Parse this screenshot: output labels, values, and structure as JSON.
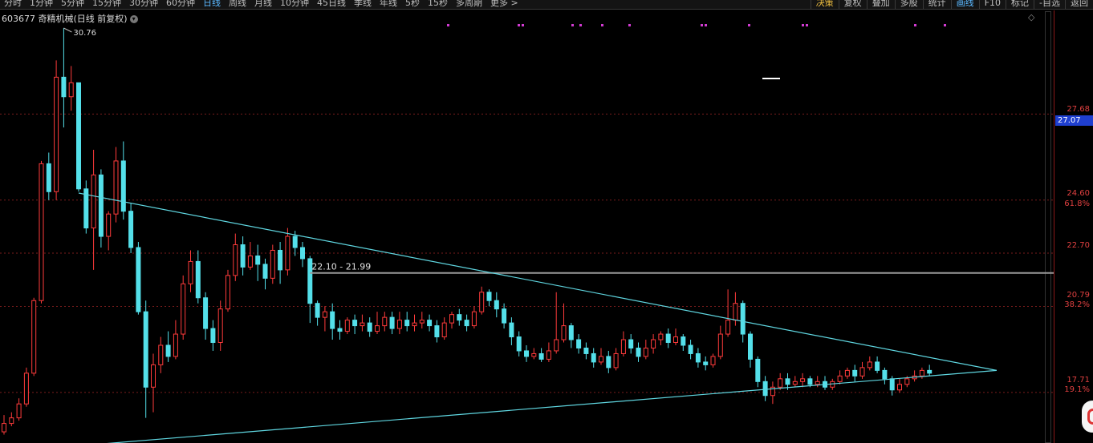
{
  "toolbar": {
    "periods": [
      "分时",
      "1分钟",
      "5分钟",
      "15分钟",
      "30分钟",
      "60分钟",
      "日线",
      "周线",
      "月线",
      "10分钟",
      "45日线",
      "季线",
      "年线",
      "5秒",
      "15秒",
      "多周期",
      "更多 >"
    ],
    "active_period": "日线",
    "right_buttons": [
      "决策",
      "复权",
      "叠加",
      "多股",
      "统计",
      "画线",
      "F10",
      "标记",
      "-自选",
      "返回"
    ]
  },
  "stock": {
    "code": "603677",
    "name": "奇精机械",
    "mode": "(日线 前复权)"
  },
  "price_labels": {
    "high_marker": "30.76",
    "range_label": "22.10 - 21.99",
    "current_price": "27.07"
  },
  "axis": {
    "ticks": [
      "27.68",
      "24.60",
      "22.70",
      "20.79",
      "17.71"
    ],
    "fib": [
      "61.8%",
      "38.2%",
      "19.1%"
    ]
  },
  "colors": {
    "up": "#ff3b3b",
    "down": "#54e0ea",
    "trend_line": "#5fd6e0",
    "level_line": "#9a9a9a",
    "grid": "#7a1c1c",
    "marker": "#d23bd2"
  },
  "chart_data": {
    "type": "candlestick",
    "ylim": [
      16.5,
      31.5
    ],
    "candles": [
      [
        16.3,
        16.6,
        16.9,
        16.2
      ],
      [
        16.6,
        16.8,
        17.0,
        16.5
      ],
      [
        16.8,
        17.3,
        17.5,
        16.7
      ],
      [
        17.3,
        18.4,
        18.6,
        17.2
      ],
      [
        18.4,
        21.0,
        21.1,
        18.3
      ],
      [
        21.0,
        25.9,
        26.0,
        20.9
      ],
      [
        25.9,
        24.9,
        26.3,
        24.6
      ],
      [
        24.9,
        29.0,
        29.6,
        24.6
      ],
      [
        29.0,
        28.3,
        30.76,
        27.2
      ],
      [
        28.3,
        28.8,
        29.4,
        27.8
      ],
      [
        28.8,
        25.0,
        25.5,
        24.9
      ],
      [
        25.0,
        23.6,
        25.3,
        23.4
      ],
      [
        23.6,
        25.5,
        26.4,
        22.1
      ],
      [
        25.5,
        23.3,
        25.7,
        22.9
      ],
      [
        23.3,
        24.1,
        24.2,
        22.8
      ],
      [
        24.1,
        26.0,
        26.5,
        23.8
      ],
      [
        26.0,
        24.2,
        26.7,
        23.9
      ],
      [
        24.2,
        22.9,
        24.5,
        22.7
      ],
      [
        22.9,
        20.6,
        23.1,
        20.5
      ],
      [
        20.6,
        17.9,
        21.0,
        16.8
      ],
      [
        17.9,
        18.7,
        19.1,
        17.0
      ],
      [
        18.7,
        19.4,
        19.7,
        18.4
      ],
      [
        19.4,
        19.0,
        19.9,
        18.8
      ],
      [
        19.0,
        19.8,
        20.3,
        18.9
      ],
      [
        19.8,
        21.6,
        21.9,
        19.6
      ],
      [
        21.6,
        22.4,
        22.8,
        21.3
      ],
      [
        22.4,
        21.1,
        22.8,
        20.9
      ],
      [
        21.1,
        20.0,
        21.3,
        19.6
      ],
      [
        20.0,
        19.5,
        20.3,
        19.2
      ],
      [
        19.5,
        20.7,
        21.0,
        19.2
      ],
      [
        20.7,
        21.9,
        22.1,
        20.6
      ],
      [
        21.9,
        23.0,
        23.4,
        21.7
      ],
      [
        23.0,
        22.2,
        23.3,
        21.9
      ],
      [
        22.2,
        22.6,
        23.1,
        22.1
      ],
      [
        22.6,
        22.3,
        23.0,
        21.7
      ],
      [
        22.3,
        21.8,
        22.5,
        21.4
      ],
      [
        21.8,
        22.8,
        23.0,
        21.6
      ],
      [
        22.8,
        22.1,
        23.1,
        21.6
      ],
      [
        22.1,
        23.3,
        23.6,
        21.9
      ],
      [
        23.3,
        22.9,
        23.5,
        22.6
      ],
      [
        22.9,
        22.5,
        23.1,
        22.2
      ],
      [
        22.5,
        20.9,
        22.6,
        20.2
      ],
      [
        20.9,
        20.4,
        21.0,
        20.1
      ],
      [
        20.4,
        20.6,
        20.8,
        19.9
      ],
      [
        20.6,
        20.0,
        20.9,
        19.6
      ],
      [
        20.0,
        19.9,
        20.3,
        19.6
      ],
      [
        19.9,
        20.3,
        20.4,
        19.8
      ],
      [
        20.3,
        20.1,
        20.5,
        19.8
      ],
      [
        20.1,
        20.2,
        20.5,
        19.9
      ],
      [
        20.2,
        19.9,
        20.4,
        19.7
      ],
      [
        19.9,
        20.1,
        20.6,
        19.8
      ],
      [
        20.1,
        20.4,
        20.6,
        19.9
      ],
      [
        20.4,
        20.0,
        20.6,
        19.8
      ],
      [
        20.0,
        20.3,
        20.6,
        19.8
      ],
      [
        20.3,
        20.1,
        20.6,
        19.9
      ],
      [
        20.1,
        20.2,
        20.5,
        19.9
      ],
      [
        20.2,
        20.3,
        20.6,
        20.0
      ],
      [
        20.3,
        20.1,
        20.5,
        19.9
      ],
      [
        20.1,
        19.7,
        20.3,
        19.5
      ],
      [
        19.7,
        20.2,
        20.4,
        19.6
      ],
      [
        20.2,
        20.5,
        20.6,
        20.0
      ],
      [
        20.5,
        20.3,
        20.7,
        20.1
      ],
      [
        20.3,
        20.1,
        20.5,
        19.9
      ],
      [
        20.1,
        20.6,
        20.8,
        20.0
      ],
      [
        20.6,
        21.3,
        21.5,
        20.5
      ],
      [
        21.3,
        21.0,
        21.4,
        20.8
      ],
      [
        21.0,
        20.7,
        21.3,
        20.4
      ],
      [
        20.7,
        20.2,
        20.9,
        20.0
      ],
      [
        20.2,
        19.7,
        20.4,
        19.4
      ],
      [
        19.7,
        19.2,
        19.9,
        19.0
      ],
      [
        19.2,
        19.0,
        19.4,
        18.8
      ],
      [
        19.0,
        19.1,
        19.3,
        18.9
      ],
      [
        19.1,
        18.9,
        19.3,
        18.8
      ],
      [
        18.9,
        19.2,
        19.5,
        18.8
      ],
      [
        19.2,
        19.6,
        21.3,
        19.1
      ],
      [
        19.6,
        20.1,
        20.9,
        19.5
      ],
      [
        20.1,
        19.6,
        20.2,
        19.3
      ],
      [
        19.6,
        19.3,
        19.8,
        19.1
      ],
      [
        19.3,
        19.1,
        19.5,
        18.9
      ],
      [
        19.1,
        18.8,
        19.3,
        18.6
      ],
      [
        18.8,
        19.0,
        19.3,
        18.7
      ],
      [
        19.0,
        18.6,
        19.2,
        18.4
      ],
      [
        18.6,
        19.1,
        19.3,
        18.5
      ],
      [
        19.1,
        19.6,
        19.9,
        19.0
      ],
      [
        19.6,
        19.3,
        19.8,
        19.1
      ],
      [
        19.3,
        19.0,
        19.5,
        18.8
      ],
      [
        19.0,
        19.3,
        19.6,
        18.9
      ],
      [
        19.3,
        19.6,
        19.8,
        19.1
      ],
      [
        19.6,
        19.8,
        19.9,
        19.4
      ],
      [
        19.8,
        19.5,
        20.0,
        19.3
      ],
      [
        19.5,
        19.7,
        20.0,
        19.4
      ],
      [
        19.7,
        19.4,
        19.8,
        19.2
      ],
      [
        19.4,
        19.1,
        19.6,
        18.9
      ],
      [
        19.1,
        18.8,
        19.3,
        18.6
      ],
      [
        18.8,
        18.7,
        19.0,
        18.5
      ],
      [
        18.7,
        19.0,
        19.1,
        18.6
      ],
      [
        19.0,
        19.8,
        20.1,
        18.9
      ],
      [
        19.8,
        20.3,
        21.4,
        19.7
      ],
      [
        20.3,
        20.9,
        21.3,
        20.1
      ],
      [
        20.9,
        19.8,
        21.0,
        19.5
      ],
      [
        19.8,
        18.9,
        19.9,
        18.6
      ],
      [
        18.9,
        18.1,
        19.0,
        17.9
      ],
      [
        18.1,
        17.6,
        18.3,
        17.4
      ],
      [
        17.6,
        17.9,
        18.1,
        17.3
      ],
      [
        17.9,
        18.2,
        18.4,
        17.8
      ],
      [
        18.2,
        18.0,
        18.4,
        17.8
      ],
      [
        18.0,
        18.1,
        18.3,
        17.9
      ],
      [
        18.1,
        18.2,
        18.4,
        17.9
      ],
      [
        18.2,
        18.0,
        18.3,
        17.9
      ],
      [
        18.0,
        18.1,
        18.3,
        17.9
      ],
      [
        18.1,
        17.9,
        18.3,
        17.8
      ],
      [
        17.9,
        18.1,
        18.2,
        17.8
      ],
      [
        18.1,
        18.3,
        18.5,
        18.0
      ],
      [
        18.3,
        18.5,
        18.6,
        18.2
      ],
      [
        18.5,
        18.3,
        18.7,
        18.1
      ],
      [
        18.3,
        18.6,
        18.8,
        18.2
      ],
      [
        18.6,
        18.8,
        19.0,
        18.5
      ],
      [
        18.8,
        18.5,
        19.0,
        18.4
      ],
      [
        18.5,
        18.2,
        18.6,
        18.0
      ],
      [
        18.2,
        17.8,
        18.3,
        17.6
      ],
      [
        17.8,
        18.0,
        18.2,
        17.7
      ],
      [
        18.0,
        18.2,
        18.3,
        17.9
      ],
      [
        18.2,
        18.3,
        18.5,
        18.1
      ],
      [
        18.3,
        18.5,
        18.6,
        18.2
      ],
      [
        18.5,
        18.4,
        18.7,
        18.3
      ]
    ],
    "triangle": {
      "upper": [
        [
          10,
          24.85
        ],
        [
          133,
          18.5
        ]
      ],
      "lower": [
        [
          10,
          15.8
        ],
        [
          133,
          18.5
        ]
      ]
    },
    "level_line": 21.99
  }
}
